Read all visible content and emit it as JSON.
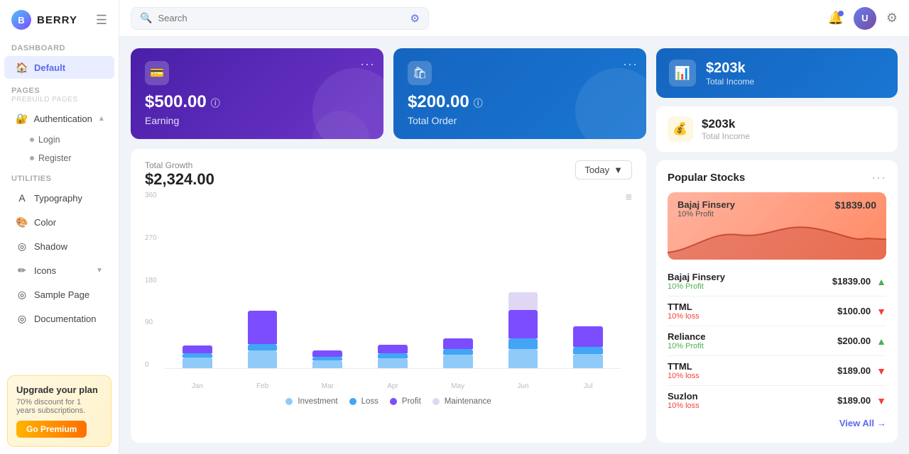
{
  "app": {
    "logo": "B",
    "name": "BERRY"
  },
  "header": {
    "search_placeholder": "Search",
    "notification_icon": "🔔",
    "settings_icon": "⚙",
    "avatar_initials": "U"
  },
  "sidebar": {
    "dashboard_label": "Dashboard",
    "default_label": "Default",
    "pages_label": "Pages",
    "prebuild_label": "Prebuild Pages",
    "authentication_label": "Authentication",
    "login_label": "Login",
    "register_label": "Register",
    "utilities_label": "Utilities",
    "typography_label": "Typography",
    "color_label": "Color",
    "shadow_label": "Shadow",
    "icons_label": "Icons",
    "sample_page_label": "Sample Page",
    "documentation_label": "Documentation",
    "upgrade_title": "Upgrade your plan",
    "upgrade_desc": "70% discount for 1 years subscriptions.",
    "upgrade_btn": "Go Premium"
  },
  "cards": {
    "earning_amount": "$500.00",
    "earning_label": "Earning",
    "total_order_amount": "$200.00",
    "total_order_label": "Total Order",
    "total_income_top_amount": "$203k",
    "total_income_top_label": "Total Income",
    "total_income_small_amount": "$203k",
    "total_income_small_label": "Total Income"
  },
  "chart": {
    "title": "Total Growth",
    "amount": "$2,324.00",
    "period_btn": "Today",
    "months": [
      "Jan",
      "Feb",
      "Mar",
      "Apr",
      "May",
      "Jun",
      "Jul"
    ],
    "legend": {
      "investment": "Investment",
      "loss": "Loss",
      "profit": "Profit",
      "maintenance": "Maintenance"
    },
    "bars": [
      {
        "investment": 30,
        "loss": 12,
        "profit": 22,
        "maintenance": 0
      },
      {
        "investment": 50,
        "loss": 18,
        "profit": 95,
        "maintenance": 0
      },
      {
        "investment": 22,
        "loss": 10,
        "profit": 18,
        "maintenance": 0
      },
      {
        "investment": 28,
        "loss": 14,
        "profit": 24,
        "maintenance": 0
      },
      {
        "investment": 38,
        "loss": 16,
        "profit": 30,
        "maintenance": 0
      },
      {
        "investment": 55,
        "loss": 30,
        "profit": 80,
        "maintenance": 50
      },
      {
        "investment": 40,
        "loss": 20,
        "profit": 58,
        "maintenance": 0
      }
    ],
    "colors": {
      "investment": "#90caf9",
      "loss": "#42a5f5",
      "profit": "#7c4dff",
      "maintenance": "#e0d7f5"
    },
    "y_labels": [
      "360",
      "270",
      "180",
      "90",
      "0"
    ]
  },
  "popular_stocks": {
    "title": "Popular Stocks",
    "chart_stock": "Bajaj Finsery",
    "chart_stock_sub": "10% Profit",
    "chart_stock_value": "$1839.00",
    "stocks": [
      {
        "name": "Bajaj Finsery",
        "sub": "10% Profit",
        "sub_type": "profit",
        "value": "$1839.00",
        "trend": "up"
      },
      {
        "name": "TTML",
        "sub": "10% loss",
        "sub_type": "loss",
        "value": "$100.00",
        "trend": "down"
      },
      {
        "name": "Reliance",
        "sub": "10% Profit",
        "sub_type": "profit",
        "value": "$200.00",
        "trend": "up"
      },
      {
        "name": "TTML",
        "sub": "10% loss",
        "sub_type": "loss",
        "value": "$189.00",
        "trend": "down"
      },
      {
        "name": "Suzlon",
        "sub": "10% loss",
        "sub_type": "loss",
        "value": "$189.00",
        "trend": "down"
      }
    ],
    "view_all": "View All"
  },
  "colors": {
    "accent": "#5b6af0",
    "sidebar_active_bg": "#e8edff",
    "sidebar_active_text": "#5b6af0"
  }
}
